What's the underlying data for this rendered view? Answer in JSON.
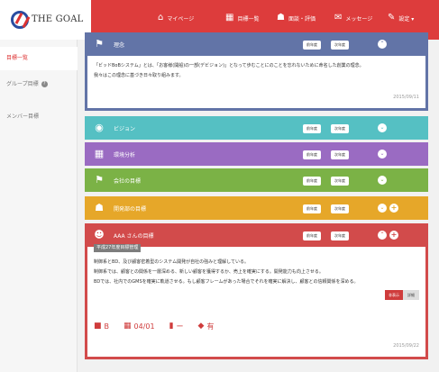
{
  "header": {
    "logo_text": "THE GOAL",
    "nav": [
      {
        "icon": "home-icon",
        "glyph": "⌂",
        "label": "マイページ"
      },
      {
        "icon": "grid-icon",
        "glyph": "▦",
        "label": "目標一覧"
      },
      {
        "icon": "people-icon",
        "glyph": "☗",
        "label": "面談・評価"
      },
      {
        "icon": "mail-icon",
        "glyph": "✉",
        "label": "メッセージ"
      },
      {
        "icon": "wrench-icon",
        "glyph": "✎",
        "label": "設定 ▾"
      }
    ]
  },
  "sidebar": {
    "items": [
      {
        "label": "目標一覧"
      },
      {
        "label": "グループ目標",
        "help": "?"
      },
      {
        "label": "メンバー目標"
      }
    ]
  },
  "panels": {
    "philosophy": {
      "title": "理念",
      "color": "#6274a7",
      "btn1": "前年度",
      "btn2": "次年度",
      "chevron": "⌃",
      "line1": "「ビッドBoBシステム」とは、「お客様(開船)の一部(デビジョン)」となって歩むことにのことを忘れないために命名した創業の理念。",
      "line2": "我々はこの理念に基づき日々取り組みます。",
      "date": "2015/09/11"
    },
    "vision": {
      "title": "ビジョン",
      "color": "#55c0c3",
      "btn1": "前年度",
      "btn2": "次年度",
      "chevron": "⌄"
    },
    "environment": {
      "title": "環境分析",
      "color": "#9a6bc2",
      "btn1": "前年度",
      "btn2": "次年度",
      "chevron": "⌄"
    },
    "company": {
      "title": "会社の目標",
      "color": "#7bb246",
      "btn1": "前年度",
      "btn2": "次年度",
      "chevron": "⌄"
    },
    "dept": {
      "title": "開発部の目標",
      "color": "#e6a729",
      "btn1": "前年度",
      "btn2": "次年度",
      "chevron": "⌄",
      "plus": "+"
    },
    "personal": {
      "title": "AAA さんの目標",
      "color": "#d24b4b",
      "btn1": "前年度",
      "btn2": "次年度",
      "chevron": "⌃",
      "plus": "+",
      "plan_tag": "平成27年度目標管理",
      "line1": "制御系とBD、及び顧客密着型のシステム開発が自社の強みと理解している。",
      "line2": "制御系では、顧客との関係を一層深める、新しい顧客を獲得するか、売上を確実にする。開発能力も向上させる。",
      "line3": "BDでは、社内でのGMSを確実に軌道させる。もし顧客フレームがあった場合でそれを確実に解決し、顧客との信頼関係を深める。",
      "hide": "非表示",
      "detail": "詳細",
      "meta": [
        {
          "icon": "bag-icon",
          "glyph": "■",
          "value": "B"
        },
        {
          "icon": "calendar-icon",
          "glyph": "▦",
          "value": "04/01"
        },
        {
          "icon": "bar-chart-icon",
          "glyph": "▮",
          "value": "ー"
        },
        {
          "icon": "tag-icon",
          "glyph": "◆",
          "value": "有"
        }
      ],
      "date": "2015/09/22"
    }
  }
}
